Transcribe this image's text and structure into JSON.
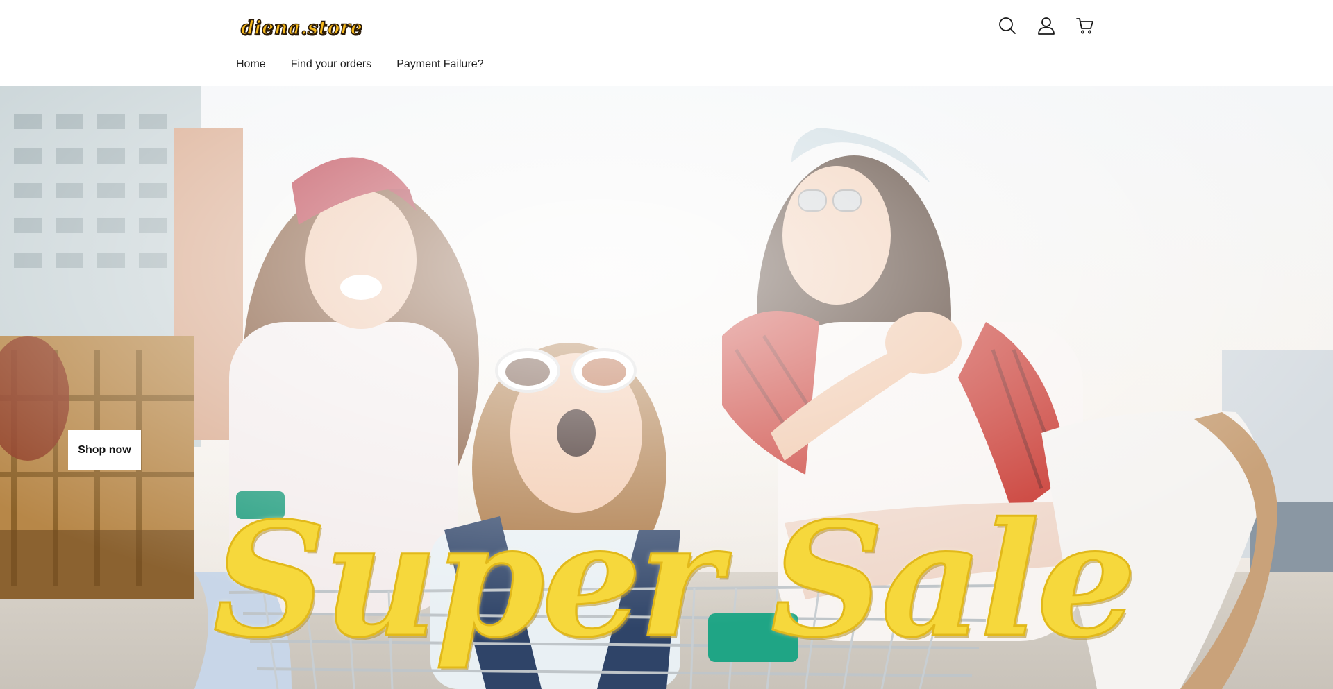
{
  "brand": {
    "logo_text": "diena.store"
  },
  "header": {
    "icons": [
      "search-icon",
      "account-icon",
      "cart-icon"
    ]
  },
  "nav": {
    "items": [
      {
        "label": "Home"
      },
      {
        "label": "Find your orders"
      },
      {
        "label": "Payment Failure?"
      }
    ]
  },
  "hero": {
    "cta_label": "Shop now",
    "headline": "Super Sale",
    "headline_color": "#f6d83c"
  }
}
